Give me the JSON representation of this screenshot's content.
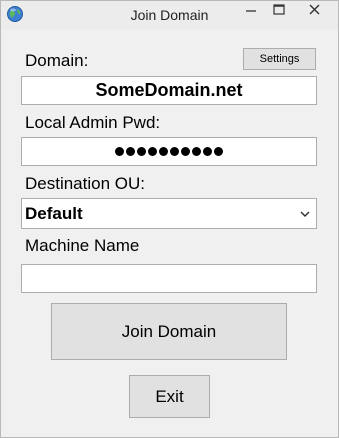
{
  "window": {
    "title": "Join Domain",
    "app_icon": "globe-icon",
    "controls": [
      "minimize-icon",
      "maximize-icon",
      "close-icon"
    ]
  },
  "form": {
    "domain_label": "Domain:",
    "settings_button": "Settings",
    "domain_value": "SomeDomain.net",
    "admin_pwd_label": "Local Admin Pwd:",
    "admin_pwd_masked_length": 10,
    "ou_label": "Destination OU:",
    "ou_selected": "Default",
    "machine_name_label": "Machine Name",
    "machine_name_value": ""
  },
  "actions": {
    "join_button": "Join Domain",
    "exit_button": "Exit"
  },
  "colors": {
    "window_bg": "#f0f0f0",
    "button_bg": "#e1e1e1",
    "border": "#adadad"
  }
}
